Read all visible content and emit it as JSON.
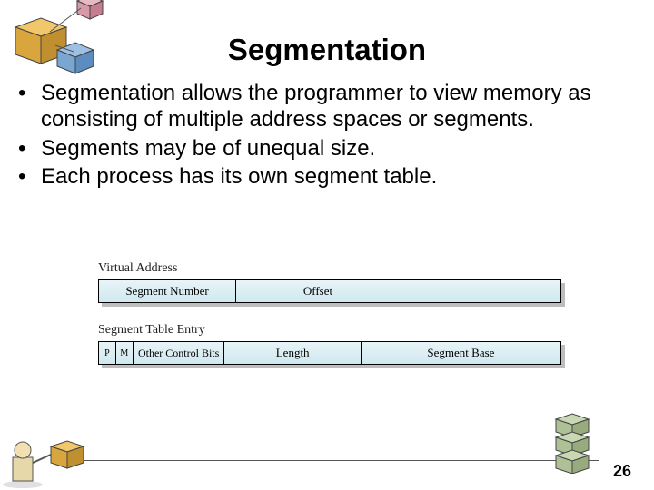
{
  "title": "Segmentation",
  "bullets": [
    "Segmentation allows the programmer to view memory as consisting of multiple address spaces or segments.",
    "Segments may be of unequal size.",
    "Each process has its own segment table."
  ],
  "diagram": {
    "virtual_address": {
      "label": "Virtual Address",
      "cells": [
        "Segment Number",
        "Offset"
      ]
    },
    "segment_table_entry": {
      "label": "Segment Table Entry",
      "cells": [
        "P",
        "M",
        "Other Control Bits",
        "Length",
        "Segment Base"
      ]
    }
  },
  "page_number": "26"
}
